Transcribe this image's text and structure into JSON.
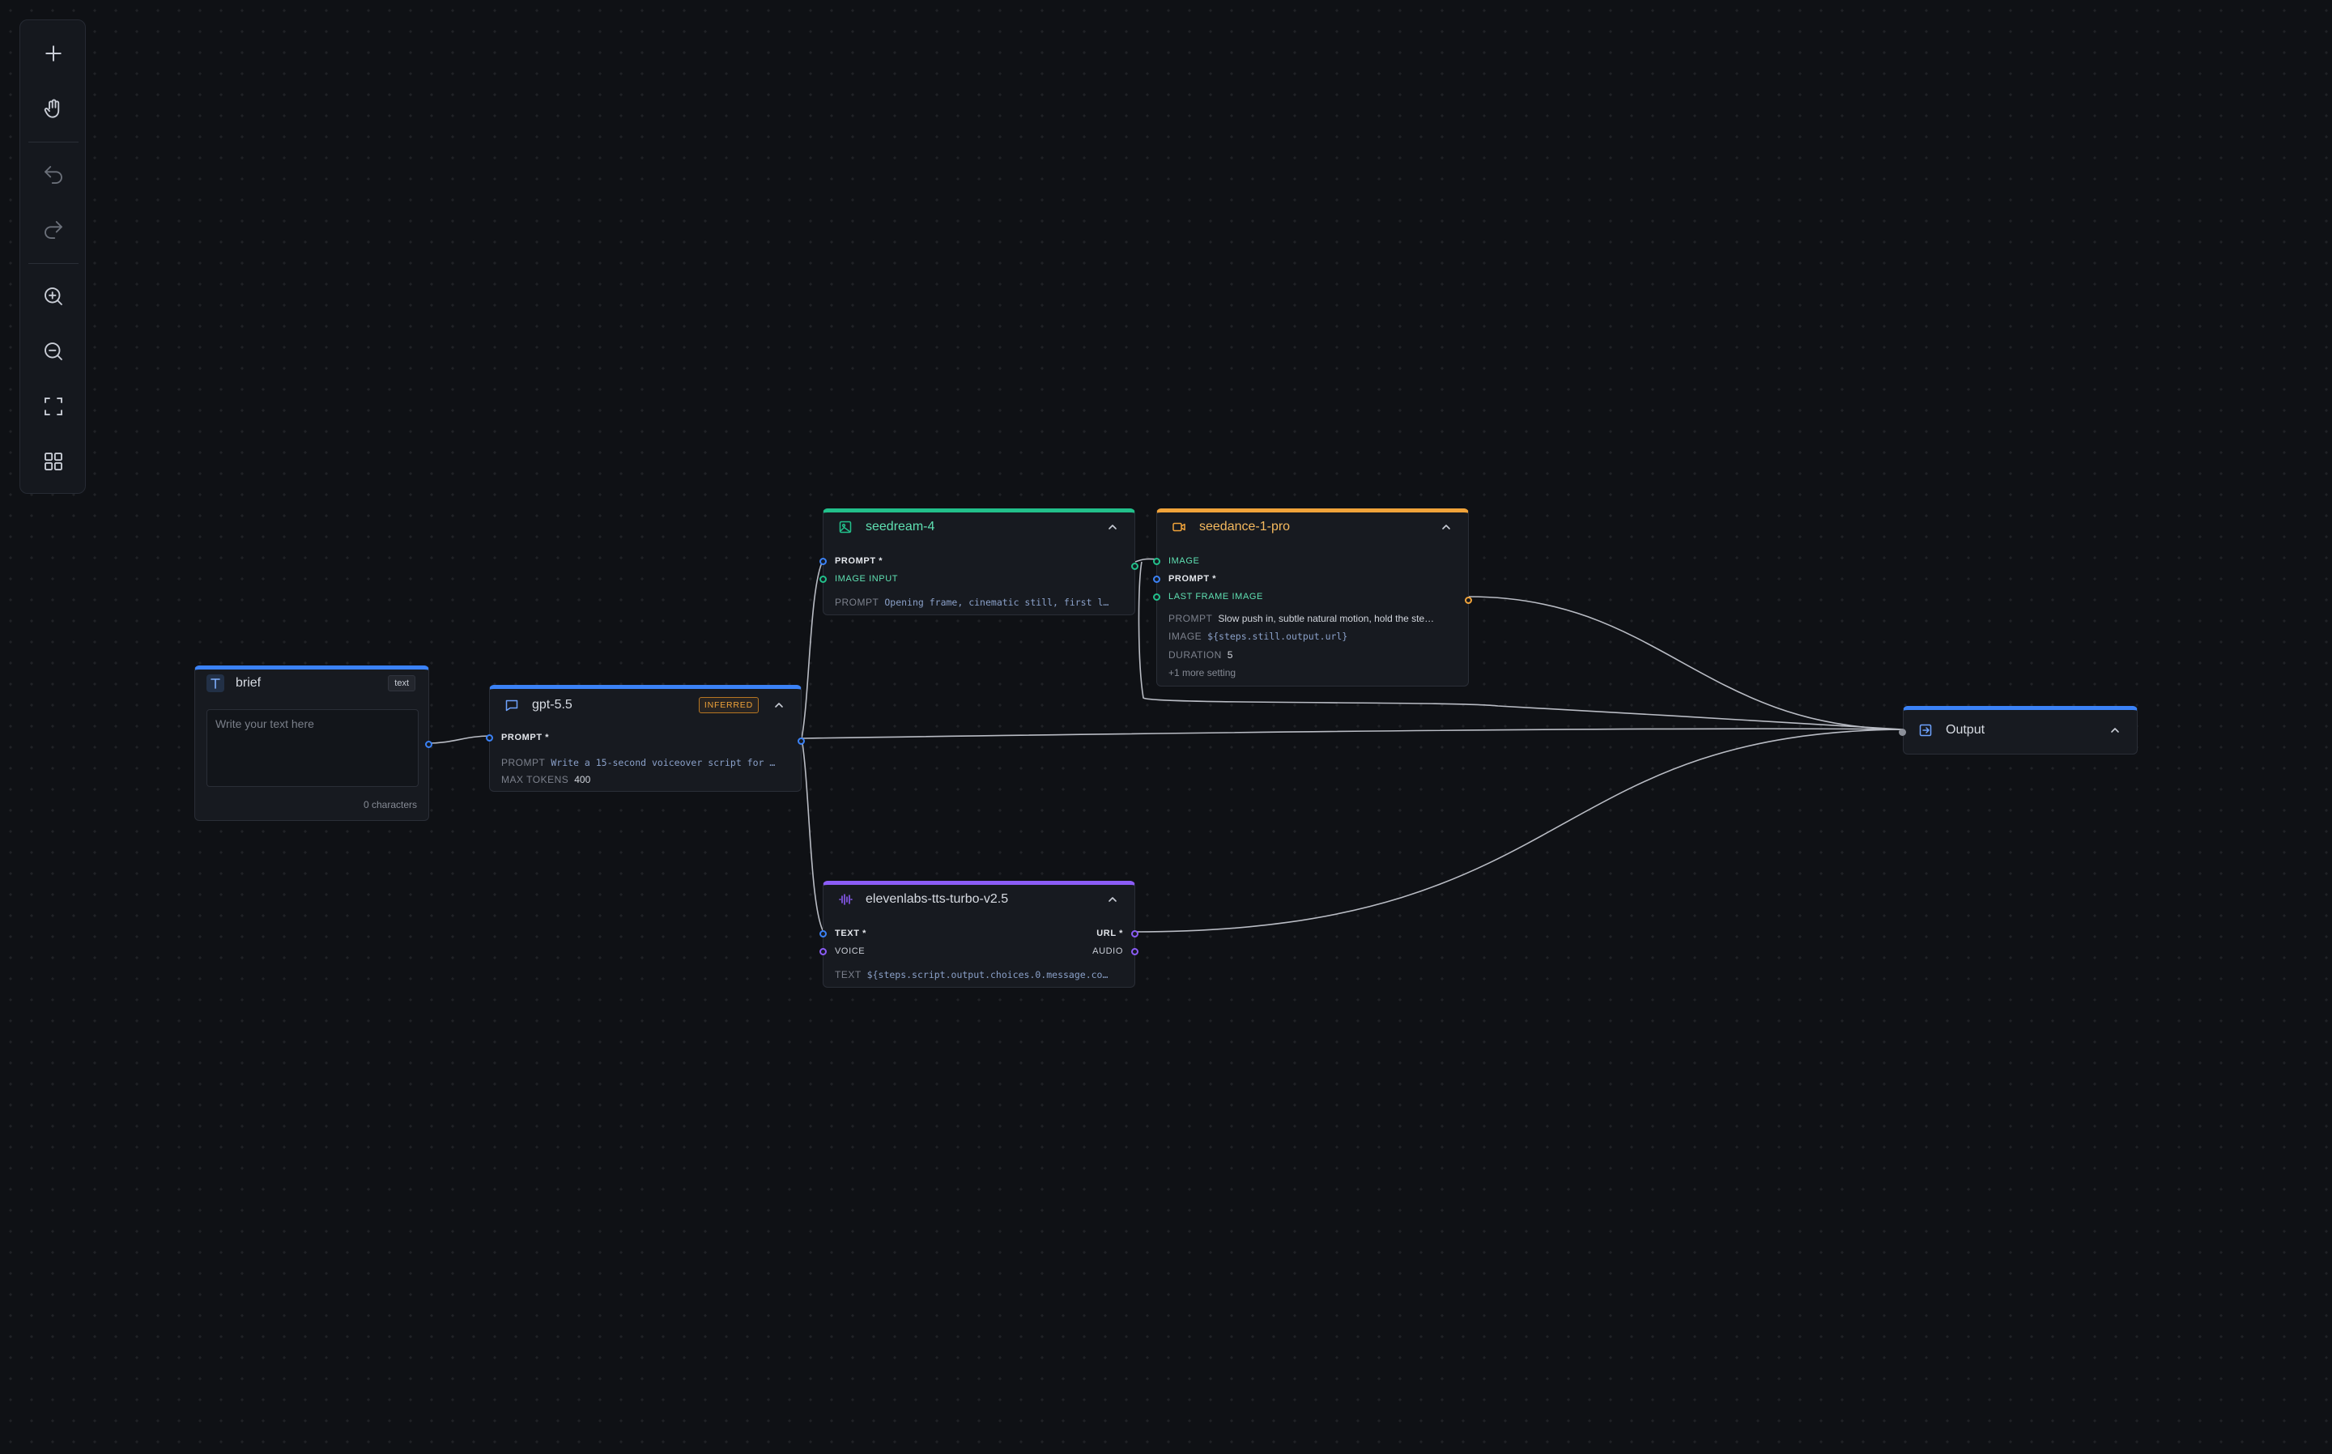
{
  "toolbar": {
    "buttons": [
      "add-icon",
      "hand-icon",
      "undo-icon",
      "redo-icon",
      "zoom-in-icon",
      "zoom-out-icon",
      "fit-view-icon",
      "grid-icon"
    ]
  },
  "colors": {
    "blue": "#3b82f6",
    "green": "#22c08b",
    "orange": "#f0a33a",
    "purple": "#8b5cf6",
    "edge": "#b9bcc4"
  },
  "nodes": {
    "brief": {
      "title": "brief",
      "tag": "text",
      "placeholder": "Write your text here",
      "char_count": "0 characters"
    },
    "gpt": {
      "title": "gpt-5.5",
      "badge": "INFERRED",
      "inputs": {
        "prompt": "PROMPT *"
      },
      "fields": {
        "prompt_label": "PROMPT",
        "prompt_value": "Write a 15-second voiceover script for …",
        "max_tokens_label": "MAX TOKENS",
        "max_tokens_value": "400"
      }
    },
    "seedream": {
      "title": "seedream-4",
      "inputs": {
        "prompt": "PROMPT *",
        "image_input": "IMAGE INPUT"
      },
      "fields": {
        "prompt_label": "PROMPT",
        "prompt_value": "Opening frame, cinematic still, first l…"
      }
    },
    "seedance": {
      "title": "seedance-1-pro",
      "inputs": {
        "image": "IMAGE",
        "prompt": "PROMPT *",
        "last_frame": "LAST FRAME IMAGE"
      },
      "fields": {
        "prompt_label": "PROMPT",
        "prompt_value": "Slow push in, subtle natural motion, hold the ste…",
        "image_label": "IMAGE",
        "image_value": "${steps.still.output.url}",
        "duration_label": "DURATION",
        "duration_value": "5",
        "more": "+1 more setting"
      }
    },
    "tts": {
      "title": "elevenlabs-tts-turbo-v2.5",
      "inputs": {
        "text": "TEXT *",
        "voice": "VOICE"
      },
      "outputs": {
        "url": "URL *",
        "audio": "AUDIO"
      },
      "fields": {
        "text_label": "TEXT",
        "text_value": "${steps.script.output.choices.0.message.co…"
      }
    },
    "output": {
      "title": "Output"
    }
  }
}
